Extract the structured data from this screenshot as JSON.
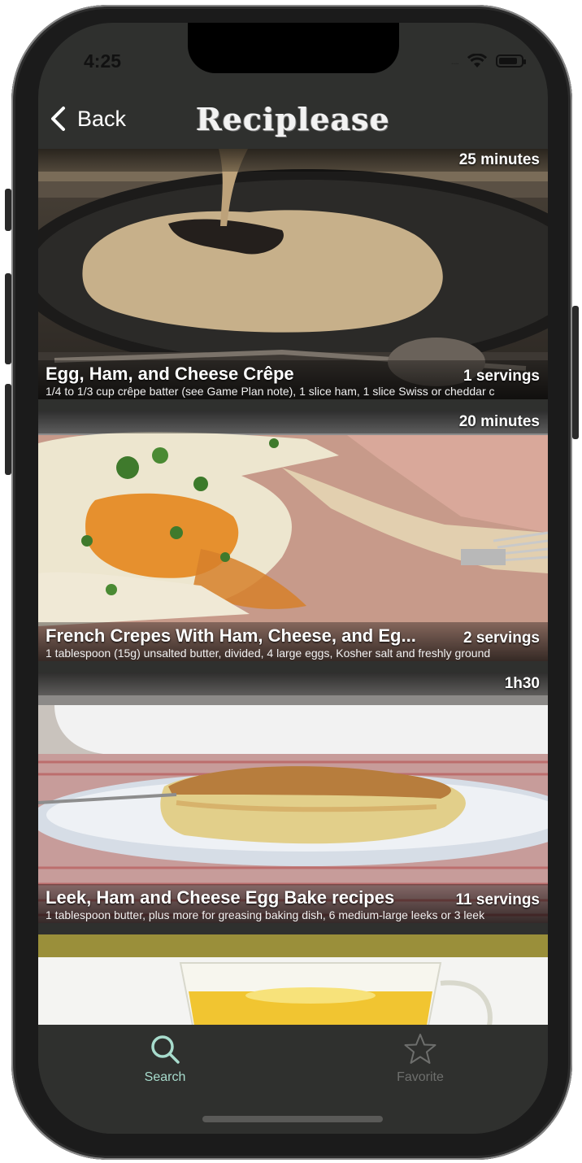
{
  "status": {
    "time": "4:25",
    "signal": "....",
    "wifi_icon": "wifi-icon",
    "battery_icon": "battery-icon"
  },
  "navbar": {
    "back_label": "Back",
    "back_icon": "chevron-left-icon",
    "title": "Reciplease"
  },
  "recipes": [
    {
      "time": "25 minutes",
      "title": "Egg, Ham, and Cheese Crêpe",
      "servings": "1 servings",
      "ingredients": "1/4 to 1/3 cup crêpe batter (see Game Plan note), 1 slice ham, 1 slice Swiss or cheddar c"
    },
    {
      "time": "20 minutes",
      "title": "French Crepes With Ham, Cheese, and Eg...",
      "servings": "2 servings",
      "ingredients": "1 tablespoon (15g) unsalted butter, divided, 4 large eggs, Kosher salt and freshly ground"
    },
    {
      "time": "1h30",
      "title": "Leek, Ham and Cheese Egg Bake recipes",
      "servings": "11 servings",
      "ingredients": "1 tablespoon butter, plus more for greasing baking dish, 6 medium-large leeks or 3 leek"
    }
  ],
  "tabbar": {
    "search": {
      "label": "Search",
      "icon": "search-icon",
      "color": "#a8dccd"
    },
    "favorite": {
      "label": "Favorite",
      "icon": "star-icon",
      "color": "#6e6f6d"
    }
  },
  "colors": {
    "background": "#2f302e",
    "accent": "#a8dccd"
  }
}
